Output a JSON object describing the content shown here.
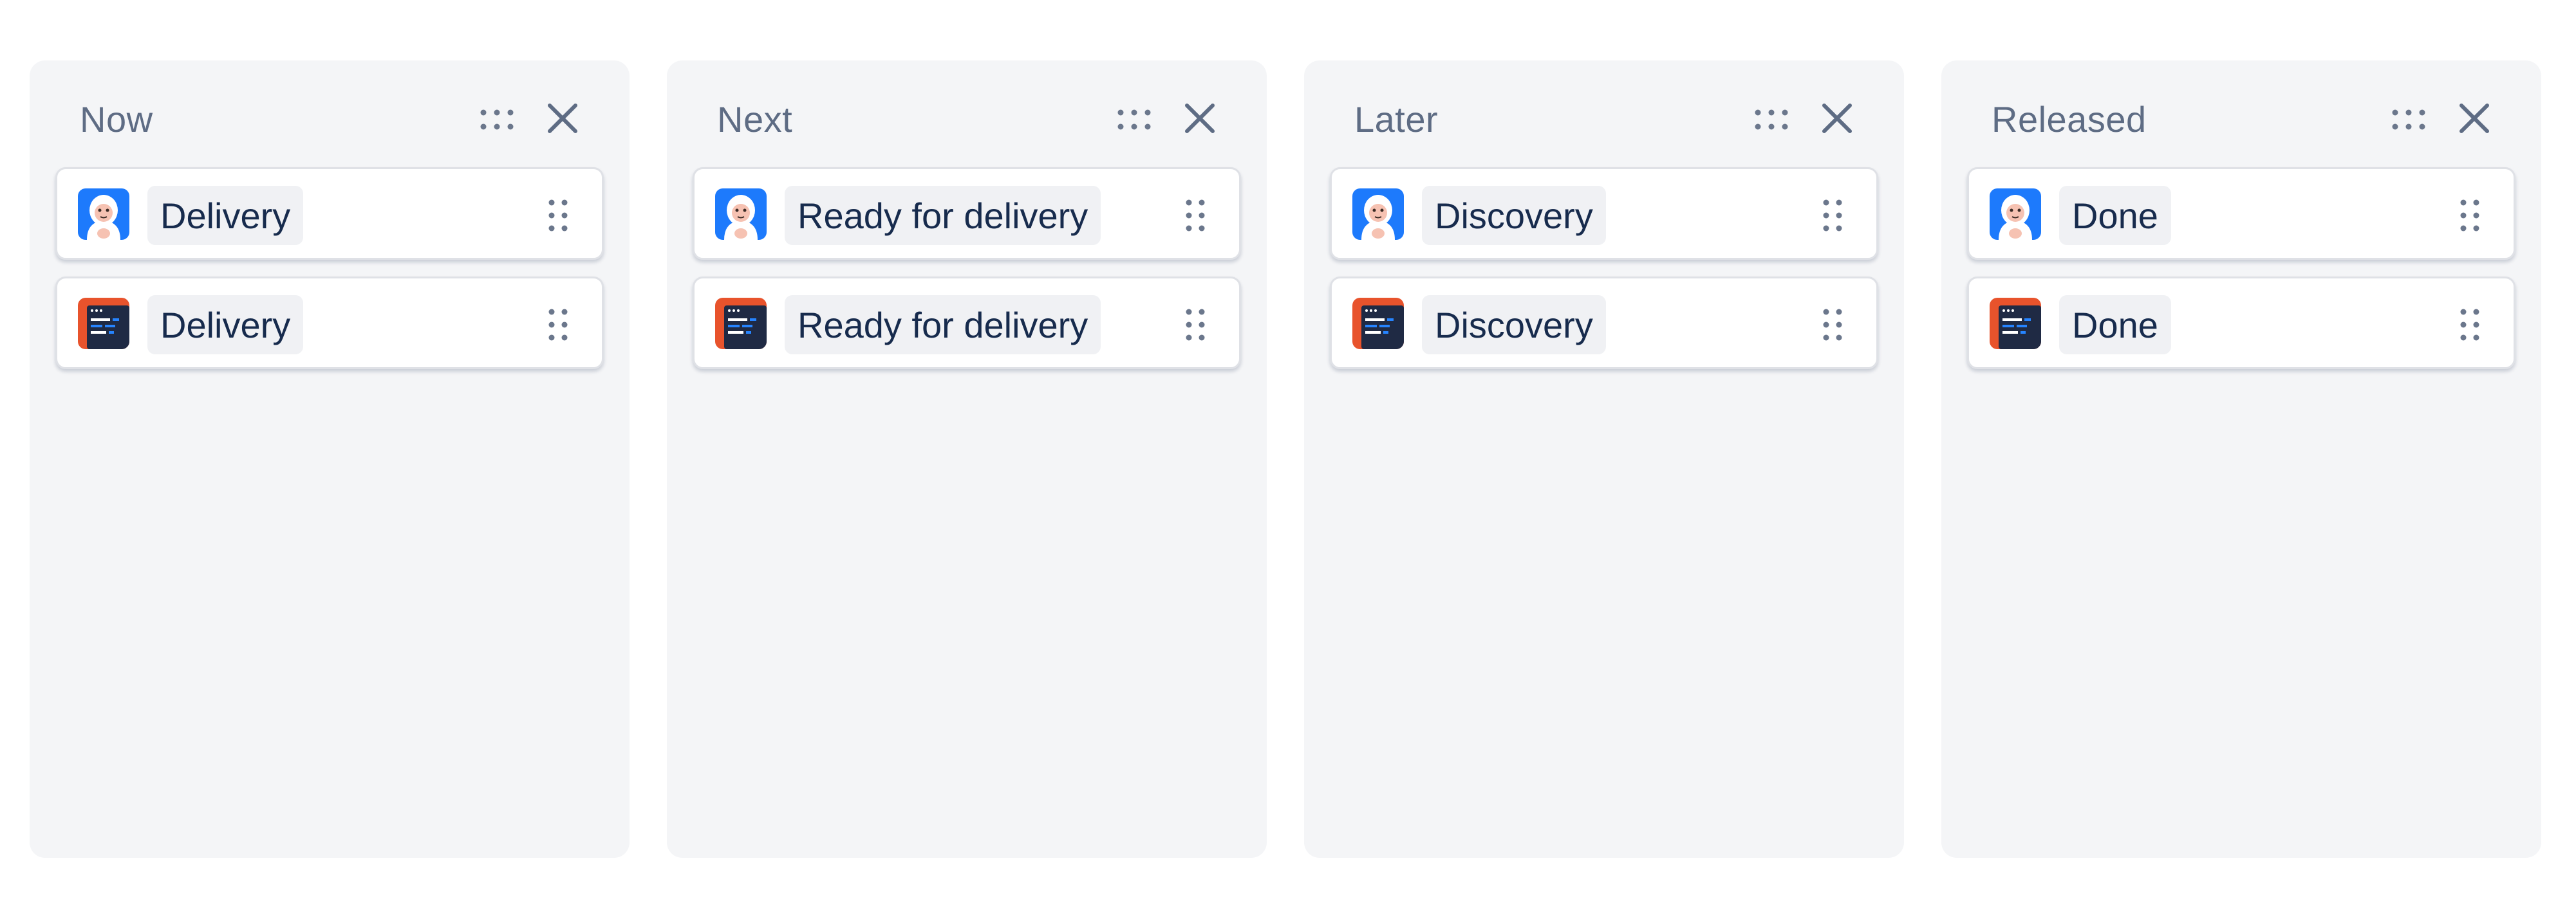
{
  "colors": {
    "column_bg": "#f4f5f7",
    "title_text": "#5e6c84",
    "chip_bg": "#f0f1f4",
    "chip_text": "#172b4d",
    "icon_gray": "#6b778c",
    "yeti_blue": "#1d7afc",
    "code_orange": "#e8532c",
    "code_navy": "#1f2a44"
  },
  "columns": [
    {
      "title": "Now",
      "cards": [
        {
          "avatar": "yeti-avatar-icon",
          "status": "Delivery"
        },
        {
          "avatar": "code-editor-avatar-icon",
          "status": "Delivery"
        }
      ]
    },
    {
      "title": "Next",
      "cards": [
        {
          "avatar": "yeti-avatar-icon",
          "status": "Ready for delivery"
        },
        {
          "avatar": "code-editor-avatar-icon",
          "status": "Ready for delivery"
        }
      ]
    },
    {
      "title": "Later",
      "cards": [
        {
          "avatar": "yeti-avatar-icon",
          "status": "Discovery"
        },
        {
          "avatar": "code-editor-avatar-icon",
          "status": "Discovery"
        }
      ]
    },
    {
      "title": "Released",
      "cards": [
        {
          "avatar": "yeti-avatar-icon",
          "status": "Done"
        },
        {
          "avatar": "code-editor-avatar-icon",
          "status": "Done"
        }
      ]
    }
  ]
}
